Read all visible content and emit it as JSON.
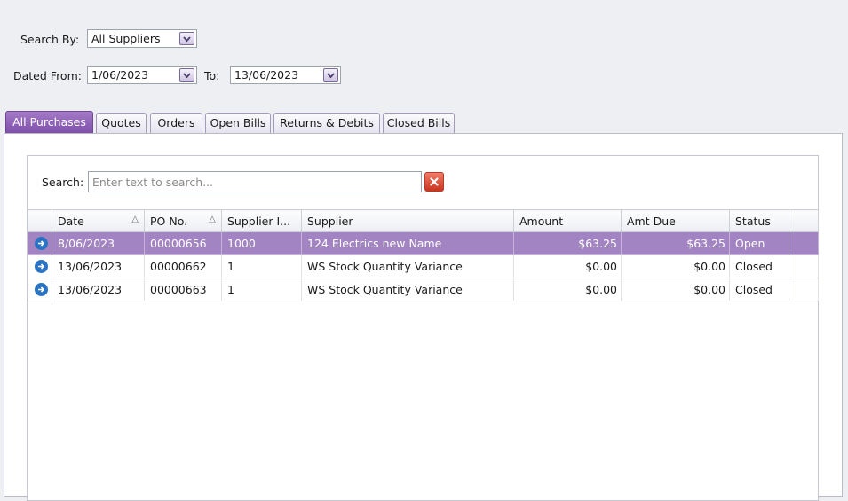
{
  "filters": {
    "search_by_label": "Search By:",
    "search_by_value": "All Suppliers",
    "dated_from_label": "Dated From:",
    "dated_from_value": "1/06/2023",
    "to_label": "To:",
    "to_value": "13/06/2023"
  },
  "tabs": [
    {
      "label": "All Purchases",
      "active": true
    },
    {
      "label": "Quotes"
    },
    {
      "label": "Orders"
    },
    {
      "label": "Open Bills"
    },
    {
      "label": "Returns & Debits"
    },
    {
      "label": "Closed Bills"
    }
  ],
  "search": {
    "label": "Search:",
    "placeholder": "Enter text to search...",
    "value": ""
  },
  "table": {
    "headers": [
      "Date",
      "PO No.",
      "Supplier I...",
      "Supplier",
      "Amount",
      "Amt Due",
      "Status"
    ],
    "rows": [
      {
        "date": "8/06/2023",
        "po": "00000656",
        "supplier_id": "1000",
        "supplier": "124 Electrics new Name",
        "amount": "$63.25",
        "amt_due": "$63.25",
        "status": "Open"
      },
      {
        "date": "13/06/2023",
        "po": "00000662",
        "supplier_id": "1",
        "supplier": "WS Stock Quantity Variance",
        "amount": "$0.00",
        "amt_due": "$0.00",
        "status": "Closed"
      },
      {
        "date": "13/06/2023",
        "po": "00000663",
        "supplier_id": "1",
        "supplier": "WS Stock Quantity Variance",
        "amount": "$0.00",
        "amt_due": "$0.00",
        "status": "Closed"
      }
    ]
  },
  "colors": {
    "accent": "#8a5bb5",
    "selected_row": "#a384c2",
    "row_icon": "#2b74c4",
    "clear_button": "#d9442e"
  },
  "icons": {
    "row_open": "arrow-right-circle-icon",
    "dropdown": "chevron-down-icon",
    "clear": "close-icon",
    "sort": "sort-ascending-icon"
  }
}
